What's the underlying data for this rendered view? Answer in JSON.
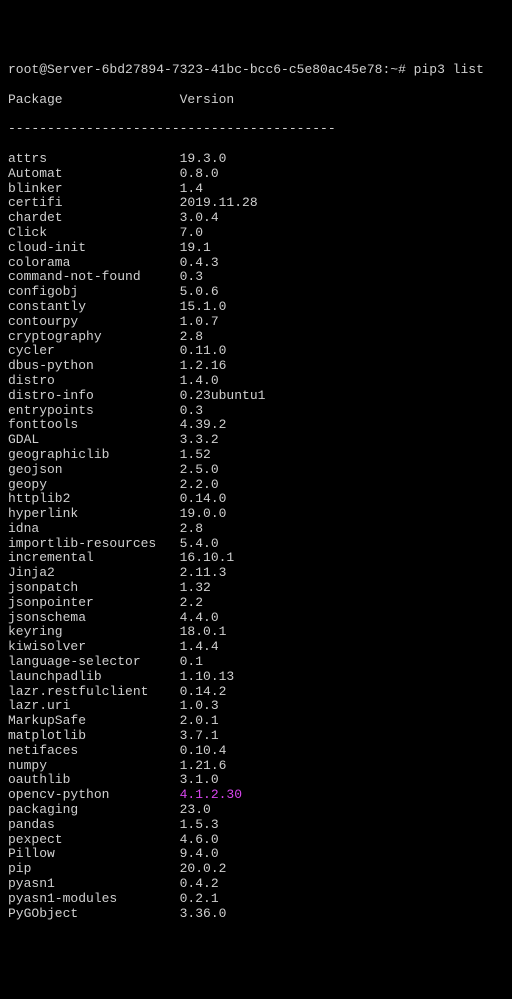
{
  "prompt": "root@Server-6bd27894-7323-41bc-bcc6-c5e80ac45e78:~# pip3 list",
  "header": {
    "col1": "Package",
    "col2": "Version"
  },
  "divider": {
    "col1": "----------------------",
    "col2": "--------------------"
  },
  "packages": [
    {
      "name": "attrs",
      "version": "19.3.0"
    },
    {
      "name": "Automat",
      "version": "0.8.0"
    },
    {
      "name": "blinker",
      "version": "1.4"
    },
    {
      "name": "certifi",
      "version": "2019.11.28"
    },
    {
      "name": "chardet",
      "version": "3.0.4"
    },
    {
      "name": "Click",
      "version": "7.0"
    },
    {
      "name": "cloud-init",
      "version": "19.1"
    },
    {
      "name": "colorama",
      "version": "0.4.3"
    },
    {
      "name": "command-not-found",
      "version": "0.3"
    },
    {
      "name": "configobj",
      "version": "5.0.6"
    },
    {
      "name": "constantly",
      "version": "15.1.0"
    },
    {
      "name": "contourpy",
      "version": "1.0.7"
    },
    {
      "name": "cryptography",
      "version": "2.8"
    },
    {
      "name": "cycler",
      "version": "0.11.0"
    },
    {
      "name": "dbus-python",
      "version": "1.2.16"
    },
    {
      "name": "distro",
      "version": "1.4.0"
    },
    {
      "name": "distro-info",
      "version": "0.23ubuntu1"
    },
    {
      "name": "entrypoints",
      "version": "0.3"
    },
    {
      "name": "fonttools",
      "version": "4.39.2"
    },
    {
      "name": "GDAL",
      "version": "3.3.2"
    },
    {
      "name": "geographiclib",
      "version": "1.52"
    },
    {
      "name": "geojson",
      "version": "2.5.0"
    },
    {
      "name": "geopy",
      "version": "2.2.0"
    },
    {
      "name": "httplib2",
      "version": "0.14.0"
    },
    {
      "name": "hyperlink",
      "version": "19.0.0"
    },
    {
      "name": "idna",
      "version": "2.8"
    },
    {
      "name": "importlib-resources",
      "version": "5.4.0"
    },
    {
      "name": "incremental",
      "version": "16.10.1"
    },
    {
      "name": "Jinja2",
      "version": "2.11.3"
    },
    {
      "name": "jsonpatch",
      "version": "1.32"
    },
    {
      "name": "jsonpointer",
      "version": "2.2"
    },
    {
      "name": "jsonschema",
      "version": "4.4.0"
    },
    {
      "name": "keyring",
      "version": "18.0.1"
    },
    {
      "name": "kiwisolver",
      "version": "1.4.4"
    },
    {
      "name": "language-selector",
      "version": "0.1"
    },
    {
      "name": "launchpadlib",
      "version": "1.10.13"
    },
    {
      "name": "lazr.restfulclient",
      "version": "0.14.2"
    },
    {
      "name": "lazr.uri",
      "version": "1.0.3"
    },
    {
      "name": "MarkupSafe",
      "version": "2.0.1"
    },
    {
      "name": "matplotlib",
      "version": "3.7.1"
    },
    {
      "name": "netifaces",
      "version": "0.10.4"
    },
    {
      "name": "numpy",
      "version": "1.21.6"
    },
    {
      "name": "oauthlib",
      "version": "3.1.0"
    },
    {
      "name": "opencv-python",
      "version": "4.1.2.30",
      "highlight": true
    },
    {
      "name": "packaging",
      "version": "23.0"
    },
    {
      "name": "pandas",
      "version": "1.5.3"
    },
    {
      "name": "pexpect",
      "version": "4.6.0"
    },
    {
      "name": "Pillow",
      "version": "9.4.0"
    },
    {
      "name": "pip",
      "version": "20.0.2"
    },
    {
      "name": "pyasn1",
      "version": "0.4.2"
    },
    {
      "name": "pyasn1-modules",
      "version": "0.2.1"
    },
    {
      "name": "PyGObject",
      "version": "3.36.0"
    }
  ]
}
